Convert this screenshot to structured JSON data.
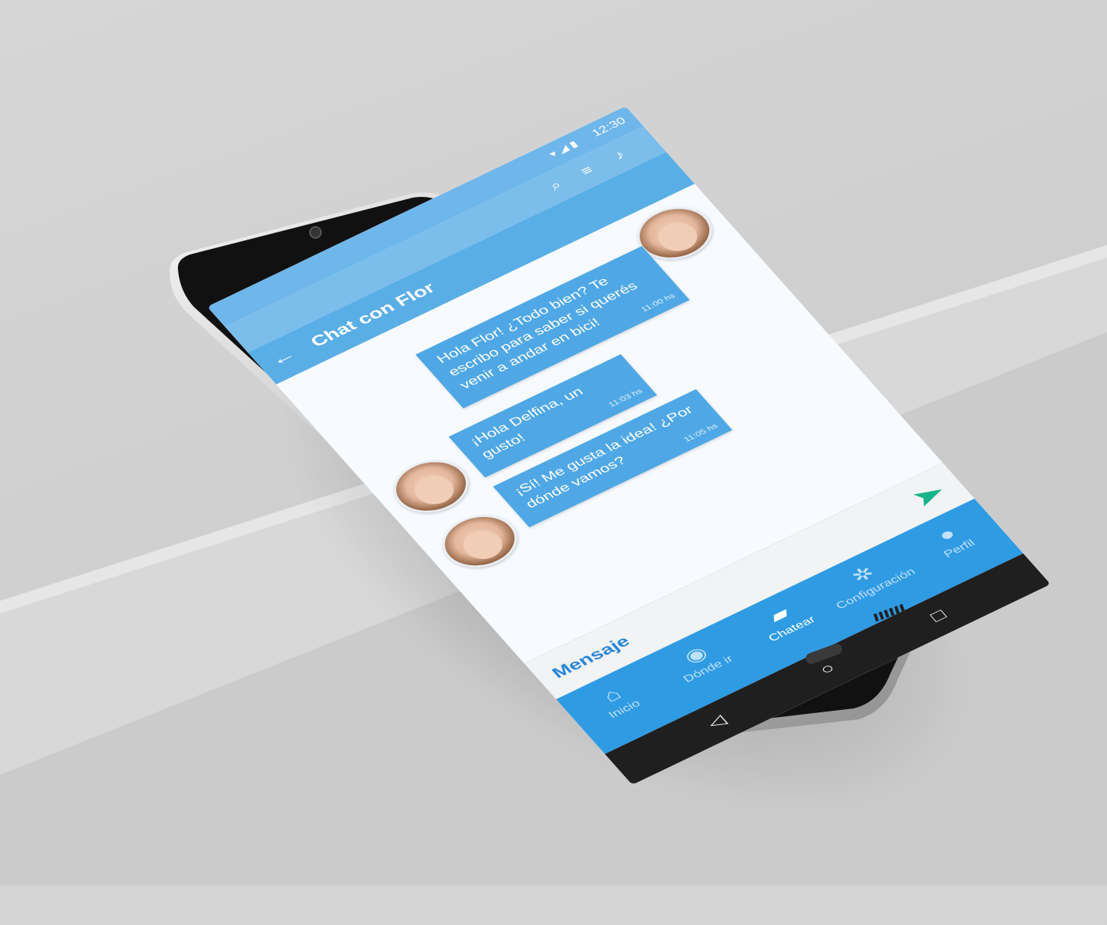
{
  "status_bar": {
    "time": "12:30",
    "icons": [
      "wifi-icon",
      "signal-icon",
      "battery-icon"
    ]
  },
  "top_actions": [
    "search-icon",
    "filter-icon",
    "bell-icon"
  ],
  "app_bar": {
    "title": "Chat con Flor",
    "back_icon": "arrow-left-icon"
  },
  "messages": [
    {
      "text": "Hola Flor! ¿Todo bien? Te escribo para saber si querés venir a andar en bici!",
      "time": "11:00 hs"
    },
    {
      "text": "¡Hola Delfina, un gusto!",
      "time": "11:03 hs"
    },
    {
      "text": "¡Sí! Me gusta la idea! ¿Por dónde vamos?",
      "time": "11:05 hs"
    }
  ],
  "composer": {
    "placeholder": "Mensaje",
    "send_icon": "send-arrow-icon"
  },
  "bottom_nav": [
    {
      "label": "Inicio",
      "icon": "home-icon",
      "active": false
    },
    {
      "label": "Dónde ir",
      "icon": "location-pin-icon",
      "active": false
    },
    {
      "label": "Chatear",
      "icon": "chat-bubble-icon",
      "active": true
    },
    {
      "label": "Configuración",
      "icon": "gear-icon",
      "active": false
    },
    {
      "label": "Perfil",
      "icon": "person-icon",
      "active": false
    }
  ],
  "system_nav": [
    "back-triangle-icon",
    "home-circle-icon",
    "recents-square-icon"
  ],
  "colors": {
    "primary": "#2f9be3",
    "bubble": "#4fa8e5",
    "send": "#18b48a"
  }
}
